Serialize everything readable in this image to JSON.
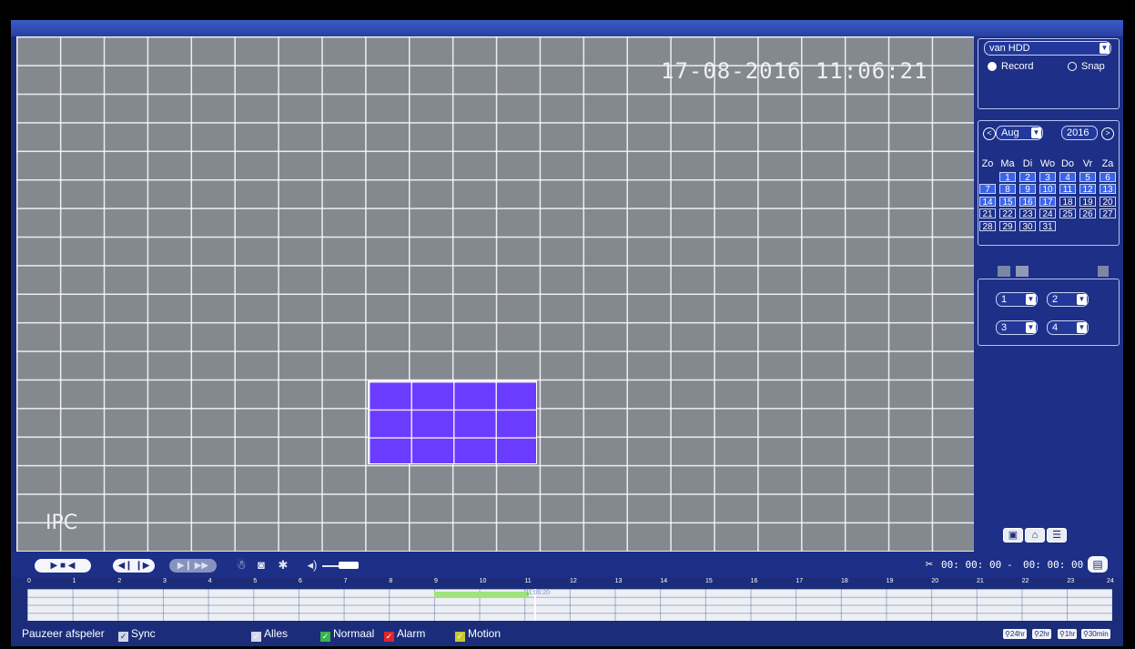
{
  "video": {
    "timestamp": "17-08-2016 11:06:21",
    "channel_label": "IPC"
  },
  "side_panel": {
    "source_select": "van HDD",
    "modes": [
      {
        "label": "Record",
        "selected": true
      },
      {
        "label": "Snap",
        "selected": false
      }
    ],
    "calendar": {
      "month": "Aug",
      "year": "2016",
      "weekdays": [
        "Zo",
        "Ma",
        "Di",
        "Wo",
        "Do",
        "Vr",
        "Za"
      ],
      "weeks": [
        [
          "",
          "1",
          "2",
          "3",
          "4",
          "5",
          "6"
        ],
        [
          "7",
          "8",
          "9",
          "10",
          "11",
          "12",
          "13"
        ],
        [
          "14",
          "15",
          "16",
          "17",
          "18",
          "19",
          "20"
        ],
        [
          "21",
          "22",
          "23",
          "24",
          "25",
          "26",
          "27"
        ],
        [
          "28",
          "29",
          "30",
          "31",
          "",
          "",
          ""
        ]
      ],
      "recorded_days": [
        "1",
        "2",
        "3",
        "4",
        "5",
        "6",
        "7",
        "8",
        "9",
        "10",
        "11",
        "12",
        "13",
        "14",
        "15",
        "16",
        "17"
      ]
    },
    "channel_selects": [
      "1",
      "2",
      "3",
      "4"
    ]
  },
  "controls": {
    "time_start": "00: 00: 00",
    "time_sep": "-",
    "time_end": "00: 00: 00"
  },
  "timeline": {
    "hours": [
      "0",
      "1",
      "2",
      "3",
      "4",
      "5",
      "6",
      "7",
      "8",
      "9",
      "10",
      "11",
      "12",
      "13",
      "14",
      "15",
      "16",
      "17",
      "18",
      "19",
      "20",
      "21",
      "22",
      "23",
      "24"
    ],
    "cursor_label": "11:06:20",
    "recorded_from_hour": 9.0,
    "recorded_to_hour": 11.1
  },
  "bottom": {
    "pause_label": "Pauzeer afspeler",
    "sync_label": "Sync",
    "filters": [
      {
        "label": "Alles",
        "color": "#cfd6e8"
      },
      {
        "label": "Normaal",
        "color": "#36b54a"
      },
      {
        "label": "Alarm",
        "color": "#e0242a"
      },
      {
        "label": "Motion",
        "color": "#c9c92e"
      }
    ],
    "zoom_options": [
      "24hr",
      "2hr",
      "1hr",
      "30min"
    ]
  },
  "colors": {
    "panel": "#1d2f86",
    "recorded_day": "#3a63e8",
    "motion_zone": "#6a3cff",
    "record_segment": "#9fe37c"
  }
}
